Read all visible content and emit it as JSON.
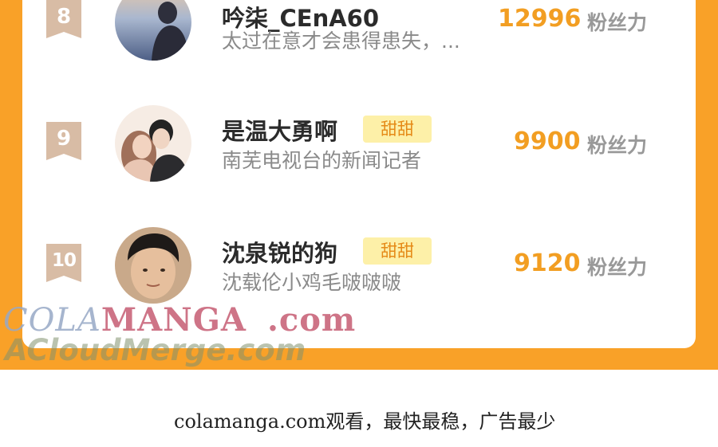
{
  "entries": [
    {
      "rank": "8",
      "name": "吟柒_CEnA60",
      "tag": "",
      "desc": "太过在意才会患得患失，...",
      "score": "12996",
      "unit": "粉丝力"
    },
    {
      "rank": "9",
      "name": "是温大勇啊",
      "tag": "甜甜",
      "desc": "南芜电视台的新闻记者",
      "score": "9900",
      "unit": "粉丝力"
    },
    {
      "rank": "10",
      "name": "沈泉锐的狗",
      "tag": "甜甜",
      "desc": "沈载伦小鸡毛啵啵啵",
      "score": "9120",
      "unit": "粉丝力"
    }
  ],
  "watermark": {
    "line1_a": "COLA",
    "line1_b": "MANGA",
    "line1_c": ".com",
    "line2": "ACloudMerge.com"
  },
  "footer": "colamanga.com观看，最快最稳，广告最少",
  "colors": {
    "frame": "#f9a128",
    "score": "#f29e22",
    "tag_bg": "#fdf0a8",
    "rank_badge": "#d8bca5"
  }
}
